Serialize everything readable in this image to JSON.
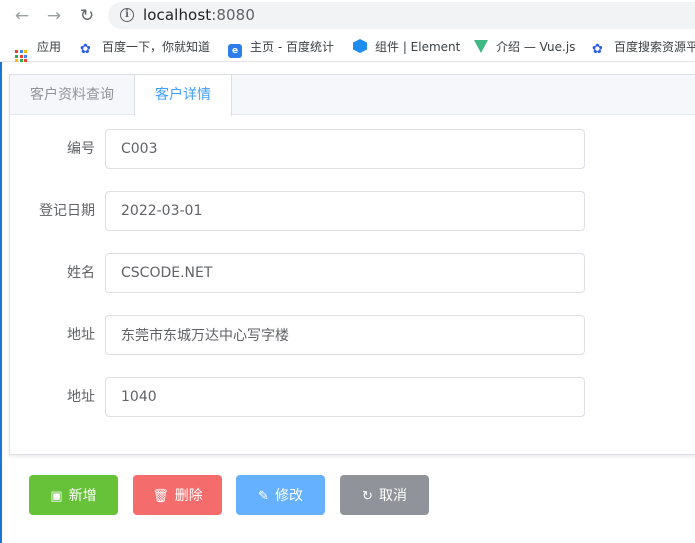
{
  "browser": {
    "url_host": "localhost",
    "url_port": ":8080"
  },
  "bookmarks": [
    {
      "label": "应用",
      "icon": "apps-grid-icon"
    },
    {
      "label": "百度一下，你就知道",
      "icon": "baidu-paw-icon"
    },
    {
      "label": "主页 - 百度统计",
      "icon": "baidu-tongji-icon"
    },
    {
      "label": "组件 | Element",
      "icon": "element-hex-icon"
    },
    {
      "label": "介绍 — Vue.js",
      "icon": "vue-logo-icon"
    },
    {
      "label": "百度搜索资源平",
      "icon": "baidu-paw-icon"
    }
  ],
  "tabs": [
    {
      "label": "客户资料查询",
      "active": false
    },
    {
      "label": "客户详情",
      "active": true
    }
  ],
  "form": {
    "fields": [
      {
        "label": "编号",
        "value": "C003"
      },
      {
        "label": "登记日期",
        "value": "2022-03-01"
      },
      {
        "label": "姓名",
        "value": "CSCODE.NET"
      },
      {
        "label": "地址",
        "value": "东莞市东城万达中心写字楼"
      },
      {
        "label": "地址",
        "value": "1040"
      }
    ]
  },
  "buttons": {
    "add": "新增",
    "delete": "删除",
    "edit": "修改",
    "cancel": "取消"
  },
  "colors": {
    "primary": "#409eff",
    "success": "#67c23a",
    "danger": "#f56c6c",
    "info": "#909399"
  }
}
